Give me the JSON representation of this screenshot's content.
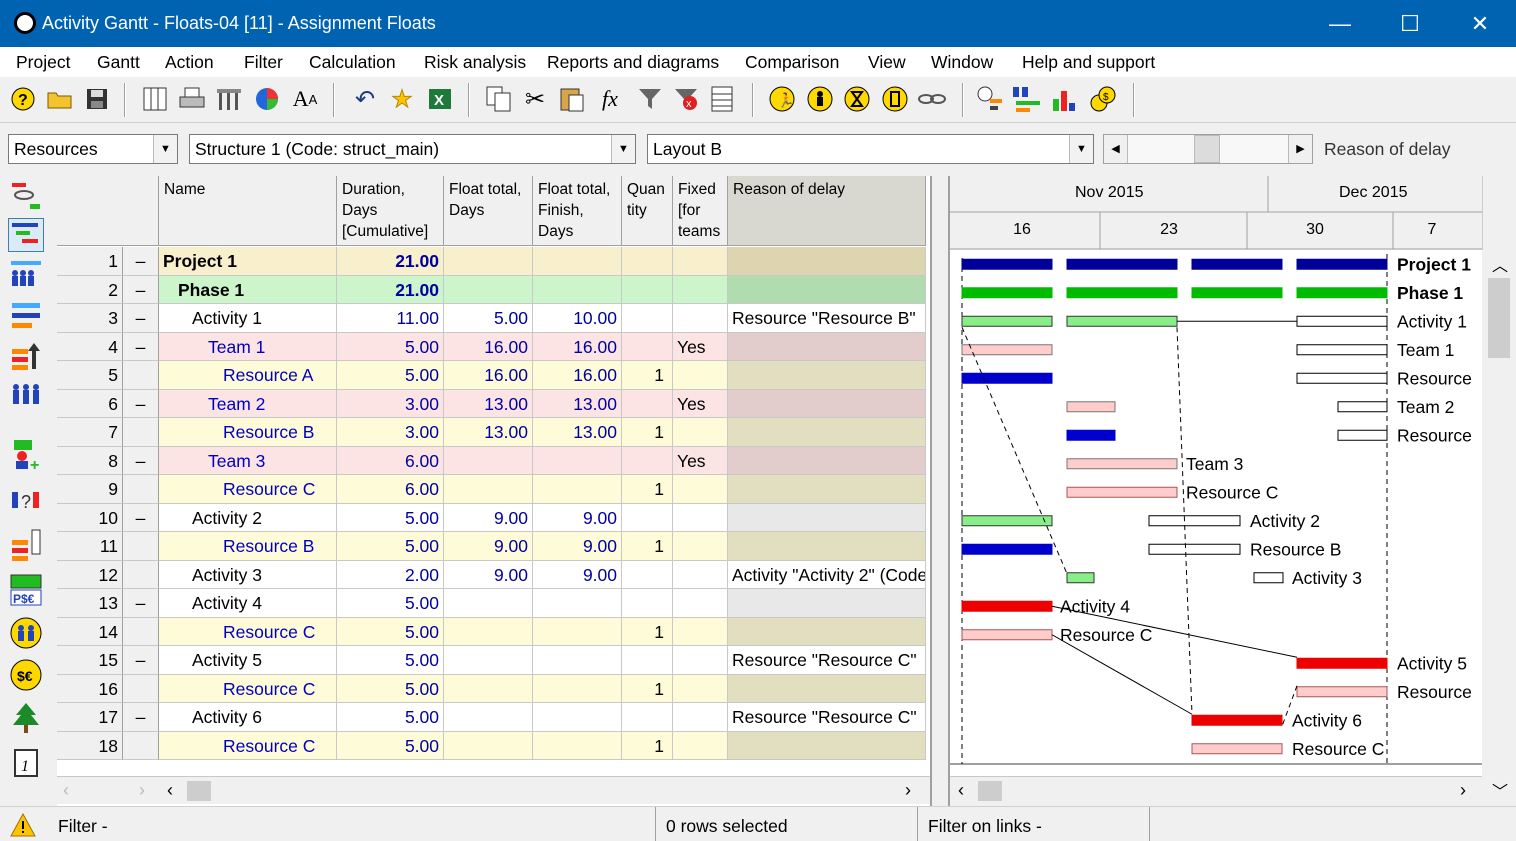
{
  "window": {
    "title": "Activity Gantt - Floats-04 [11] - Assignment Floats",
    "minimize": "—",
    "maximize": "☐",
    "close": "✕"
  },
  "menu": [
    "Project",
    "Gantt",
    "Action",
    "Filter",
    "Calculation",
    "Risk analysis",
    "Reports and diagrams",
    "Comparison",
    "View",
    "Window",
    "Help and support"
  ],
  "selectors": {
    "mode": "Resources",
    "structure": "Structure 1 (Code: struct_main)",
    "layout": "Layout B",
    "column_label": "Reason of delay"
  },
  "columns": {
    "name": "Name",
    "duration": "Duration,\nDays\n[Cumulative]",
    "float_total": "Float total,\nDays",
    "float_finish": "Float total,\nFinish,\nDays",
    "quantity": "Quan\ntity",
    "fixed": "Fixed\n[for\nteams",
    "reason": "Reason of delay"
  },
  "rows": [
    {
      "n": "1",
      "tog": "–",
      "name": "Project 1",
      "dur": "21.00",
      "ft": "",
      "ff": "",
      "q": "",
      "fx": "",
      "reason": "",
      "style": "project"
    },
    {
      "n": "2",
      "tog": "–",
      "name": "Phase 1",
      "dur": "21.00",
      "ft": "",
      "ff": "",
      "q": "",
      "fx": "",
      "reason": "",
      "style": "phase"
    },
    {
      "n": "3",
      "tog": "–",
      "name": "Activity 1",
      "dur": "11.00",
      "ft": "5.00",
      "ff": "10.00",
      "q": "",
      "fx": "",
      "reason": "Resource \"Resource B\"",
      "style": "activity"
    },
    {
      "n": "4",
      "tog": "–",
      "name": "Team 1",
      "dur": "5.00",
      "ft": "16.00",
      "ff": "16.00",
      "q": "",
      "fx": "Yes",
      "reason": "",
      "style": "team"
    },
    {
      "n": "5",
      "tog": "",
      "name": "Resource A",
      "dur": "5.00",
      "ft": "16.00",
      "ff": "16.00",
      "q": "1",
      "fx": "",
      "reason": "",
      "style": "resource"
    },
    {
      "n": "6",
      "tog": "–",
      "name": "Team 2",
      "dur": "3.00",
      "ft": "13.00",
      "ff": "13.00",
      "q": "",
      "fx": "Yes",
      "reason": "",
      "style": "team"
    },
    {
      "n": "7",
      "tog": "",
      "name": "Resource B",
      "dur": "3.00",
      "ft": "13.00",
      "ff": "13.00",
      "q": "1",
      "fx": "",
      "reason": "",
      "style": "resource"
    },
    {
      "n": "8",
      "tog": "–",
      "name": "Team 3",
      "dur": "6.00",
      "ft": "",
      "ff": "",
      "q": "",
      "fx": "Yes",
      "reason": "",
      "style": "team"
    },
    {
      "n": "9",
      "tog": "",
      "name": "Resource C",
      "dur": "6.00",
      "ft": "",
      "ff": "",
      "q": "1",
      "fx": "",
      "reason": "",
      "style": "resource"
    },
    {
      "n": "10",
      "tog": "–",
      "name": "Activity 2",
      "dur": "5.00",
      "ft": "9.00",
      "ff": "9.00",
      "q": "",
      "fx": "",
      "reason": "",
      "style": "activity"
    },
    {
      "n": "11",
      "tog": "",
      "name": "Resource B",
      "dur": "5.00",
      "ft": "9.00",
      "ff": "9.00",
      "q": "1",
      "fx": "",
      "reason": "",
      "style": "resource"
    },
    {
      "n": "12",
      "tog": "",
      "name": "Activity 3",
      "dur": "2.00",
      "ft": "9.00",
      "ff": "9.00",
      "q": "",
      "fx": "",
      "reason": "Activity \"Activity 2\" (Code",
      "style": "activity"
    },
    {
      "n": "13",
      "tog": "–",
      "name": "Activity 4",
      "dur": "5.00",
      "ft": "",
      "ff": "",
      "q": "",
      "fx": "",
      "reason": "",
      "style": "activity"
    },
    {
      "n": "14",
      "tog": "",
      "name": "Resource C",
      "dur": "5.00",
      "ft": "",
      "ff": "",
      "q": "1",
      "fx": "",
      "reason": "",
      "style": "resource"
    },
    {
      "n": "15",
      "tog": "–",
      "name": "Activity 5",
      "dur": "5.00",
      "ft": "",
      "ff": "",
      "q": "",
      "fx": "",
      "reason": "Resource \"Resource C\"",
      "style": "activity"
    },
    {
      "n": "16",
      "tog": "",
      "name": "Resource C",
      "dur": "5.00",
      "ft": "",
      "ff": "",
      "q": "1",
      "fx": "",
      "reason": "",
      "style": "resource"
    },
    {
      "n": "17",
      "tog": "–",
      "name": "Activity 6",
      "dur": "5.00",
      "ft": "",
      "ff": "",
      "q": "",
      "fx": "",
      "reason": "Resource \"Resource C\"",
      "style": "activity"
    },
    {
      "n": "18",
      "tog": "",
      "name": "Resource C",
      "dur": "5.00",
      "ft": "",
      "ff": "",
      "q": "1",
      "fx": "",
      "reason": "",
      "style": "resource"
    }
  ],
  "gantt": {
    "months": [
      "Nov 2015",
      "Dec 2015"
    ],
    "days": [
      "16",
      "23",
      "30",
      "7"
    ],
    "labels": [
      "Project 1",
      "Phase 1",
      "Activity 1",
      "Team 1",
      "Resource",
      "Team 2",
      "Resource",
      "Team 3",
      "Resource C",
      "Activity 2",
      "Resource B",
      "Activity 3",
      "Activity 4",
      "Resource C",
      "Activity 5",
      "Resource",
      "Activity 6",
      "Resource C"
    ]
  },
  "status": {
    "filter": "Filter -",
    "selection": "0 rows selected",
    "link_filter": "Filter on links -"
  },
  "colors": {
    "titlebar": "#0063b1",
    "project_bar": "#000099",
    "phase_bar": "#00bb00",
    "activity_bar": "#88ee88",
    "team_bar": "#ffcccc",
    "resource_bar": "#0000cc",
    "critical_bar": "#ee0000"
  }
}
